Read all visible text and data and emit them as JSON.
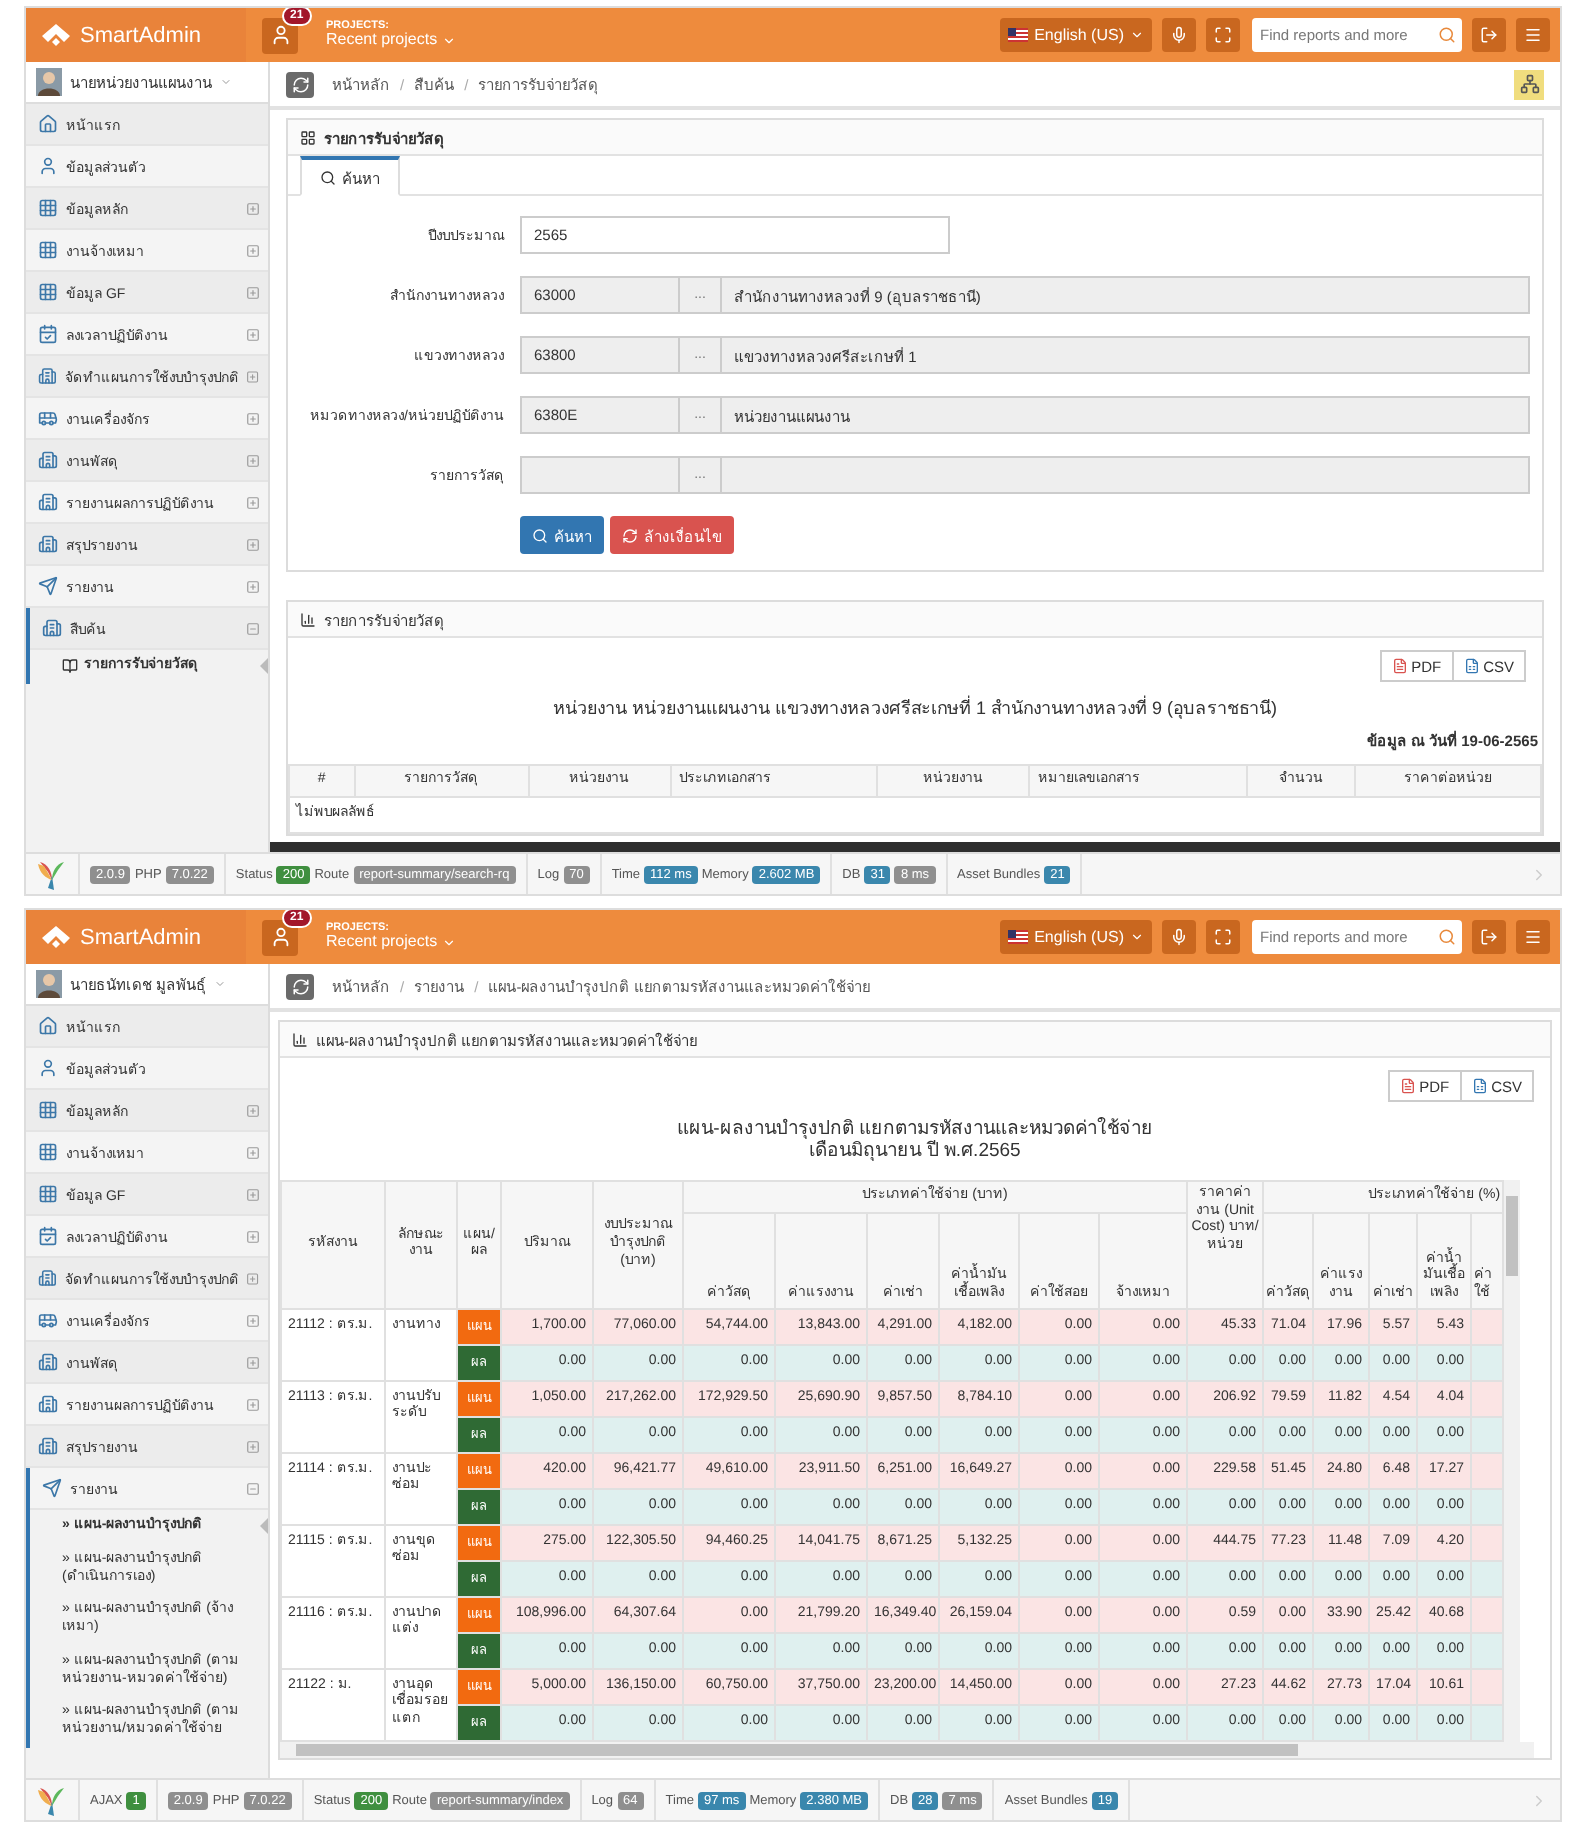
{
  "screens": [
    {
      "kind": "search",
      "header": {
        "logo": "SmartAdmin",
        "notification_count": "21",
        "projects_label": "PROJECTS:",
        "projects_menu": "Recent projects",
        "language": "English (US)",
        "search": {
          "placeholder": "Find reports and more"
        }
      },
      "user": {
        "name": "นายหน่วยงานแผนงาน"
      },
      "sidebar": {
        "items": [
          {
            "label": "หน้าแรก",
            "kind": "link"
          },
          {
            "label": "ข้อมูลส่วนตัว",
            "kind": "link"
          },
          {
            "label": "ข้อมูลหลัก",
            "kind": "group",
            "expanded": false
          },
          {
            "label": "งานจ้างเหมา",
            "kind": "group",
            "expanded": false
          },
          {
            "label": "ข้อมูล GF",
            "kind": "group",
            "expanded": false
          },
          {
            "label": "ลงเวลาปฏิบัติงาน",
            "kind": "group",
            "expanded": false
          },
          {
            "label": "จัดทำแผนการใช้งบบำรุงปกติ",
            "kind": "group",
            "expanded": false
          },
          {
            "label": "งานเครื่องจักร",
            "kind": "group",
            "expanded": false
          },
          {
            "label": "งานพัสดุ",
            "kind": "group",
            "expanded": false
          },
          {
            "label": "รายงานผลการปฏิบัติงาน",
            "kind": "group",
            "expanded": false
          },
          {
            "label": "สรุปรายงาน",
            "kind": "group",
            "expanded": false
          },
          {
            "label": "รายงาน",
            "kind": "group",
            "expanded": false
          },
          {
            "label": "สืบค้น",
            "kind": "group",
            "expanded": true,
            "children": [
              {
                "label": "รายการรับจ่ายวัสดุ",
                "kind": "book",
                "selected": true
              }
            ]
          }
        ]
      },
      "breadcrumb": {
        "separator": "/",
        "items": [
          "หน้าหลัก",
          "สืบค้น",
          "รายการรับจ่ายวัสดุ"
        ]
      },
      "layout_toggle": true,
      "search_panel": {
        "title": "รายการรับจ่ายวัสดุ",
        "tabs": [
          {
            "label": "ค้นหา",
            "selected": true
          }
        ],
        "fields": [
          {
            "kind": "text",
            "label": "ปีงบประมาณ",
            "value": "2565"
          },
          {
            "kind": "lookup",
            "label": "สำนักงานทางหลวง",
            "code": "63000",
            "button": "...",
            "name": "สำนักงานทางหลวงที่ 9 (อุบลราชธานี)"
          },
          {
            "kind": "lookup",
            "label": "แขวงทางหลวง",
            "code": "63800",
            "button": "...",
            "name": "แขวงทางหลวงศรีสะเกษที่ 1"
          },
          {
            "kind": "lookup",
            "label": "หมวดทางหลวง/หน่วยปฏิบัติงาน",
            "code": "6380E",
            "button": "...",
            "name": "หน่วยงานแผนงาน"
          },
          {
            "kind": "lookup",
            "label": "รายการวัสดุ",
            "button": "..."
          }
        ],
        "buttons": [
          {
            "label": "ค้นหา",
            "kind": "primary"
          },
          {
            "label": "ล้างเงื่อนไข",
            "kind": "danger"
          }
        ]
      },
      "result_panel": {
        "title": "รายการรับจ่ายวัสดุ",
        "exports": [
          {
            "label": "PDF",
            "kind": "pdf"
          },
          {
            "label": "CSV",
            "kind": "csv"
          }
        ],
        "heading": "หน่วยงาน หน่วยงานแผนงาน แขวงทางหลวงศรีสะเกษที่ 1 สำนักงานทางหลวงที่ 9 (อุบลราชธานี)",
        "as_of": "ข้อมูล ณ วันที่ 19-06-2565",
        "columns": [
          "#",
          "รายการวัสดุ",
          "หน่วยงาน",
          "ประเภทเอกสาร",
          "หน่วยงาน",
          "หมายเลขเอกสาร",
          "จำนวน",
          "ราคาต่อหน่วย"
        ],
        "empty_text": "ไม่พบผลลัพธ์"
      },
      "status_bar": {
        "segments": [
          [
            {
              "kind": "badge",
              "text": "2.0.9",
              "color": "#8f8f8f"
            },
            {
              "kind": "label",
              "text": "PHP"
            },
            {
              "kind": "badge",
              "text": "7.0.22",
              "color": "#8f8f8f"
            }
          ],
          [
            {
              "kind": "label",
              "text": "Status"
            },
            {
              "kind": "badge",
              "text": "200",
              "color": "#3f8f3f"
            },
            {
              "kind": "label",
              "text": "Route"
            },
            {
              "kind": "badge",
              "text": "report-summary/search-rq",
              "color": "#8f8f8f"
            }
          ],
          [
            {
              "kind": "label",
              "text": "Log"
            },
            {
              "kind": "badge",
              "text": "70",
              "color": "#8f8f8f"
            }
          ],
          [
            {
              "kind": "label",
              "text": "Time"
            },
            {
              "kind": "badge",
              "text": "112 ms",
              "color": "#3a87ad"
            },
            {
              "kind": "label",
              "text": "Memory"
            },
            {
              "kind": "badge",
              "text": "2.602 MB",
              "color": "#3a87ad"
            }
          ],
          [
            {
              "kind": "label",
              "text": "DB"
            },
            {
              "kind": "badge",
              "text": "31",
              "color": "#3a87ad"
            },
            {
              "kind": "badge",
              "text": "8 ms",
              "color": "#8f8f8f"
            }
          ],
          [
            {
              "kind": "label",
              "text": "Asset Bundles"
            },
            {
              "kind": "badge",
              "text": "21",
              "color": "#3a87ad"
            }
          ]
        ]
      }
    },
    {
      "kind": "report",
      "header": {
        "logo": "SmartAdmin",
        "notification_count": "21",
        "projects_label": "PROJECTS:",
        "projects_menu": "Recent projects",
        "language": "English (US)",
        "search": {
          "placeholder": "Find reports and more"
        }
      },
      "user": {
        "name": "นายธนัทเดช มูลพันธุ์"
      },
      "sidebar": {
        "items": [
          {
            "label": "หน้าแรก",
            "kind": "link"
          },
          {
            "label": "ข้อมูลส่วนตัว",
            "kind": "link"
          },
          {
            "label": "ข้อมูลหลัก",
            "kind": "group",
            "expanded": false
          },
          {
            "label": "งานจ้างเหมา",
            "kind": "group",
            "expanded": false
          },
          {
            "label": "ข้อมูล GF",
            "kind": "group",
            "expanded": false
          },
          {
            "label": "ลงเวลาปฏิบัติงาน",
            "kind": "group",
            "expanded": false
          },
          {
            "label": "จัดทำแผนการใช้งบบำรุงปกติ",
            "kind": "group",
            "expanded": false
          },
          {
            "label": "งานเครื่องจักร",
            "kind": "group",
            "expanded": false
          },
          {
            "label": "งานพัสดุ",
            "kind": "group",
            "expanded": false
          },
          {
            "label": "รายงานผลการปฏิบัติงาน",
            "kind": "group",
            "expanded": false
          },
          {
            "label": "สรุปรายงาน",
            "kind": "group",
            "expanded": false
          },
          {
            "label": "รายงาน",
            "kind": "group",
            "expanded": true,
            "children": [
              {
                "label": "» แผน-ผลงานบำรุงปกติ",
                "kind": "plain",
                "selected": true
              },
              {
                "label": "» แผน-ผลงานบำรุงปกติ (ดำเนินการเอง)",
                "kind": "plain",
                "selected": false
              },
              {
                "label": "» แผน-ผลงานบำรุงปกติ (จ้างเหมา)",
                "kind": "plain",
                "selected": false
              },
              {
                "label": "» แผน-ผลงานบำรุงปกติ (ตามหน่วยงาน-หมวดค่าใช้จ่าย)",
                "kind": "plain",
                "selected": false
              },
              {
                "label": "» แผน-ผลงานบำรุงปกติ (ตามหน่วยงาน/หมวดค่าใช้จ่าย",
                "kind": "plain",
                "selected": false
              }
            ]
          }
        ]
      },
      "breadcrumb": {
        "separator": "/",
        "items": [
          "หน้าหลัก",
          "รายงาน",
          "แผน-ผลงานบำรุงปกติ แยกตามรหัสงานและหมวดค่าใช้จ่าย"
        ]
      },
      "report_panel": {
        "title": "แผน-ผลงานบำรุงปกติ แยกตามรหัสงานและหมวดค่าใช้จ่าย",
        "exports": [
          {
            "label": "PDF",
            "kind": "pdf"
          },
          {
            "label": "CSV",
            "kind": "csv"
          }
        ],
        "heading_lines": [
          "แผน-ผลงานบำรุงปกติ แยกตามรหัสงานและหมวดค่าใช้จ่าย",
          "เดือนมิถุนายน ปี พ.ศ.2565"
        ],
        "table": {
          "lead_columns": [
            "รหัสงาน",
            "ลักษณะงาน",
            "แผน/ผล",
            "ปริมาณ",
            "งบประมาณบำรุงปกติ (บาท)"
          ],
          "baht_group": {
            "label": "ประเภทค่าใช้จ่าย (บาท)",
            "columns": [
              "ค่าวัสดุ",
              "ค่าแรงงาน",
              "ค่าเช่า",
              "ค่าน้ำมันเชื้อเพลิง",
              "ค่าใช้สอย",
              "จ้างเหมา"
            ]
          },
          "unit_cost": "ราคาค่างาน (Unit Cost) บาท/หน่วย",
          "percent_group": {
            "label": "ประเภทค่าใช้จ่าย (%)",
            "columns": [
              "ค่าวัสดุ",
              "ค่าแรงงาน",
              "ค่าเช่า",
              "ค่าน้ำมันเชื้อเพลิง",
              "ค่า ใช้"
            ]
          },
          "groups": [
            {
              "code": "21112 : ตร.ม.",
              "work": "งานทาง",
              "rows": [
                {
                  "kind": "plan",
                  "label": "แผน",
                  "values": [
                    "1,700.00",
                    "77,060.00",
                    "54,744.00",
                    "13,843.00",
                    "4,291.00",
                    "4,182.00",
                    "0.00",
                    "0.00",
                    "45.33",
                    "71.04",
                    "17.96",
                    "5.57",
                    "5.43"
                  ]
                },
                {
                  "kind": "result",
                  "label": "ผล",
                  "values": [
                    "0.00",
                    "0.00",
                    "0.00",
                    "0.00",
                    "0.00",
                    "0.00",
                    "0.00",
                    "0.00",
                    "0.00",
                    "0.00",
                    "0.00",
                    "0.00",
                    "0.00"
                  ]
                }
              ]
            },
            {
              "code": "21113 : ตร.ม.",
              "work": "งานปรับระดับ",
              "rows": [
                {
                  "kind": "plan",
                  "label": "แผน",
                  "values": [
                    "1,050.00",
                    "217,262.00",
                    "172,929.50",
                    "25,690.90",
                    "9,857.50",
                    "8,784.10",
                    "0.00",
                    "0.00",
                    "206.92",
                    "79.59",
                    "11.82",
                    "4.54",
                    "4.04"
                  ]
                },
                {
                  "kind": "result",
                  "label": "ผล",
                  "values": [
                    "0.00",
                    "0.00",
                    "0.00",
                    "0.00",
                    "0.00",
                    "0.00",
                    "0.00",
                    "0.00",
                    "0.00",
                    "0.00",
                    "0.00",
                    "0.00",
                    "0.00"
                  ]
                }
              ]
            },
            {
              "code": "21114 : ตร.ม.",
              "work": "งานปะซ่อม",
              "rows": [
                {
                  "kind": "plan",
                  "label": "แผน",
                  "values": [
                    "420.00",
                    "96,421.77",
                    "49,610.00",
                    "23,911.50",
                    "6,251.00",
                    "16,649.27",
                    "0.00",
                    "0.00",
                    "229.58",
                    "51.45",
                    "24.80",
                    "6.48",
                    "17.27"
                  ]
                },
                {
                  "kind": "result",
                  "label": "ผล",
                  "values": [
                    "0.00",
                    "0.00",
                    "0.00",
                    "0.00",
                    "0.00",
                    "0.00",
                    "0.00",
                    "0.00",
                    "0.00",
                    "0.00",
                    "0.00",
                    "0.00",
                    "0.00"
                  ]
                }
              ]
            },
            {
              "code": "21115 : ตร.ม.",
              "work": "งานขุดซ่อม",
              "rows": [
                {
                  "kind": "plan",
                  "label": "แผน",
                  "values": [
                    "275.00",
                    "122,305.50",
                    "94,460.25",
                    "14,041.75",
                    "8,671.25",
                    "5,132.25",
                    "0.00",
                    "0.00",
                    "444.75",
                    "77.23",
                    "11.48",
                    "7.09",
                    "4.20"
                  ]
                },
                {
                  "kind": "result",
                  "label": "ผล",
                  "values": [
                    "0.00",
                    "0.00",
                    "0.00",
                    "0.00",
                    "0.00",
                    "0.00",
                    "0.00",
                    "0.00",
                    "0.00",
                    "0.00",
                    "0.00",
                    "0.00",
                    "0.00"
                  ]
                }
              ]
            },
            {
              "code": "21116 : ตร.ม.",
              "work": "งานปาดแต่ง",
              "rows": [
                {
                  "kind": "plan",
                  "label": "แผน",
                  "values": [
                    "108,996.00",
                    "64,307.64",
                    "0.00",
                    "21,799.20",
                    "16,349.40",
                    "26,159.04",
                    "0.00",
                    "0.00",
                    "0.59",
                    "0.00",
                    "33.90",
                    "25.42",
                    "40.68"
                  ]
                },
                {
                  "kind": "result",
                  "label": "ผล",
                  "values": [
                    "0.00",
                    "0.00",
                    "0.00",
                    "0.00",
                    "0.00",
                    "0.00",
                    "0.00",
                    "0.00",
                    "0.00",
                    "0.00",
                    "0.00",
                    "0.00",
                    "0.00"
                  ]
                }
              ]
            },
            {
              "code": "21122 : ม.",
              "work": "งานอุดเชื่อมรอยแตก",
              "rows": [
                {
                  "kind": "plan",
                  "label": "แผน",
                  "values": [
                    "5,000.00",
                    "136,150.00",
                    "60,750.00",
                    "37,750.00",
                    "23,200.00",
                    "14,450.00",
                    "0.00",
                    "0.00",
                    "27.23",
                    "44.62",
                    "27.73",
                    "17.04",
                    "10.61"
                  ]
                },
                {
                  "kind": "result",
                  "label": "ผล",
                  "values": [
                    "0.00",
                    "0.00",
                    "0.00",
                    "0.00",
                    "0.00",
                    "0.00",
                    "0.00",
                    "0.00",
                    "0.00",
                    "0.00",
                    "0.00",
                    "0.00",
                    "0.00"
                  ]
                }
              ]
            }
          ]
        }
      },
      "status_bar": {
        "segments": [
          [
            {
              "kind": "label",
              "text": "AJAX"
            },
            {
              "kind": "badge",
              "text": "1",
              "color": "#3f8f3f"
            }
          ],
          [
            {
              "kind": "badge",
              "text": "2.0.9",
              "color": "#8f8f8f"
            },
            {
              "kind": "label",
              "text": "PHP"
            },
            {
              "kind": "badge",
              "text": "7.0.22",
              "color": "#8f8f8f"
            }
          ],
          [
            {
              "kind": "label",
              "text": "Status"
            },
            {
              "kind": "badge",
              "text": "200",
              "color": "#3f8f3f"
            },
            {
              "kind": "label",
              "text": "Route"
            },
            {
              "kind": "badge",
              "text": "report-summary/index",
              "color": "#8f8f8f"
            }
          ],
          [
            {
              "kind": "label",
              "text": "Log"
            },
            {
              "kind": "badge",
              "text": "64",
              "color": "#8f8f8f"
            }
          ],
          [
            {
              "kind": "label",
              "text": "Time"
            },
            {
              "kind": "badge",
              "text": "97 ms",
              "color": "#3a87ad"
            },
            {
              "kind": "label",
              "text": "Memory"
            },
            {
              "kind": "badge",
              "text": "2.380 MB",
              "color": "#3a87ad"
            }
          ],
          [
            {
              "kind": "label",
              "text": "DB"
            },
            {
              "kind": "badge",
              "text": "28",
              "color": "#3a87ad"
            },
            {
              "kind": "badge",
              "text": "7 ms",
              "color": "#8f8f8f"
            }
          ],
          [
            {
              "kind": "label",
              "text": "Asset Bundles"
            },
            {
              "kind": "badge",
              "text": "19",
              "color": "#3a87ad"
            }
          ]
        ]
      }
    }
  ]
}
